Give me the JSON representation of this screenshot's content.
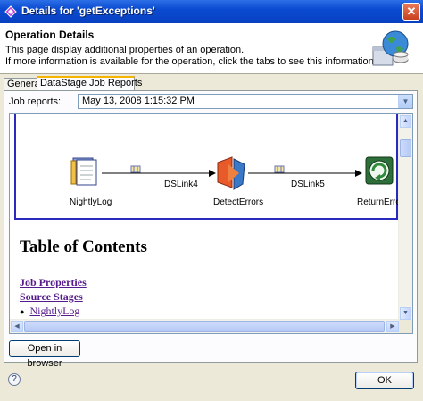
{
  "window": {
    "title": "Details for 'getExceptions'"
  },
  "header": {
    "title": "Operation Details",
    "desc_line1": "This page display additional properties of an operation.",
    "desc_line2": "If more information is available for the operation, click the tabs to see this information."
  },
  "tabs": [
    {
      "label": "General",
      "active": false
    },
    {
      "label": "DataStage Job Reports",
      "active": true
    }
  ],
  "job_reports": {
    "label": "Job reports:",
    "selected": "May 13, 2008 1:15:32 PM"
  },
  "diagram": {
    "nodes": [
      "NightlyLog",
      "DetectErrors",
      "ReturnErrors"
    ],
    "links": [
      "DSLink4",
      "DSLink5"
    ]
  },
  "report": {
    "heading": "Table of Contents",
    "link_job_properties": "Job Properties",
    "link_source_stages": "Source Stages",
    "bullet_item": "NightlyLog"
  },
  "buttons": {
    "open_in_browser": "Open in browser",
    "ok": "OK",
    "help": "?"
  },
  "colors": {
    "titlebar": "#0a4bd1",
    "diagram_border": "#2a2abf",
    "visited_link": "#551a8b"
  }
}
